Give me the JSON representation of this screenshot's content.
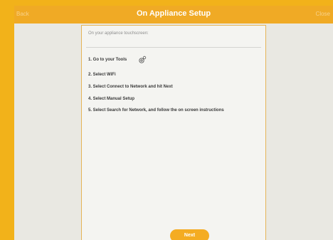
{
  "header": {
    "back_label": "Back",
    "title": "On Appliance Setup",
    "close_label": "Close"
  },
  "instructions": {
    "intro": "On your appliance touchscreen:",
    "steps": [
      "1. Go to your Tools",
      "2. Select WiFi",
      "3. Select Connect to Network and hit Next",
      "4. Select Manual Setup",
      "5. Select Search for Network, and follow the on screen instructions"
    ]
  },
  "icons": {
    "tools": "tools-gear-icon"
  },
  "footer": {
    "next_label": "Next"
  },
  "colors": {
    "outer_frame": "#f2b21a",
    "header_bg": "#f0aa25",
    "accent": "#f4ac22",
    "card_border": "#e5b457",
    "text": "#3a3a3a"
  }
}
